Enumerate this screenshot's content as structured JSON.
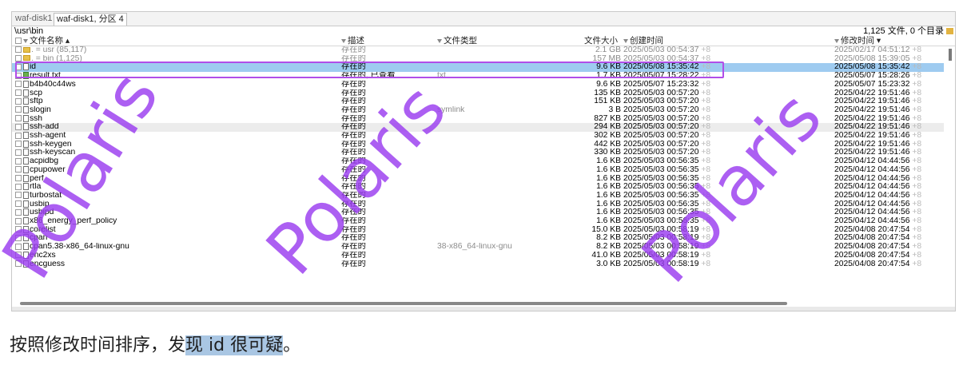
{
  "tabs": {
    "inactive": "waf-disk1",
    "active": "waf-disk1, 分区 4"
  },
  "path": "\\usr\\bin",
  "summary": "1,125 文件, 0 个目录",
  "columns": {
    "name": "文件名称 ▴",
    "desc": "描述",
    "type": "文件类型",
    "size": "文件大小",
    "ctime": "创建时间",
    "mtime": "修改时间 ▾"
  },
  "rows": [
    {
      "name": ".  =  usr (85,117)",
      "desc": "存在的",
      "type": "",
      "size": "2.1 GB",
      "ctime": "2025/05/03  00:54:37",
      "tz": "+8",
      "mtime": "2025/02/17  04:51:12",
      "mtz": "+8",
      "icon": "folder",
      "dim": true
    },
    {
      "name": ".  =  bin (1,125)",
      "desc": "存在的",
      "type": "",
      "size": "157 MB",
      "ctime": "2025/05/03  00:54:37",
      "tz": "+8",
      "mtime": "2025/05/08  15:39:05",
      "mtz": "+8",
      "icon": "folder",
      "dim": true
    },
    {
      "name": "id",
      "desc": "存在的",
      "type": "",
      "size": "9.6 KB",
      "ctime": "2025/05/08  15:35:42",
      "tz": "+8",
      "mtime": "2025/05/08  15:35:42",
      "mtz": "+8",
      "icon": "file",
      "selected": true
    },
    {
      "name": "result.txt",
      "desc": "存在的, 已查看",
      "type": "txt",
      "size": "1.7 KB",
      "ctime": "2025/05/07  15:28:22",
      "tz": "+8",
      "mtime": "2025/05/07  15:28:26",
      "mtz": "+8",
      "icon": "green"
    },
    {
      "name": "b4b40c44ws",
      "desc": "存在的",
      "type": "",
      "size": "9.6 KB",
      "ctime": "2025/05/07  15:23:32",
      "tz": "+8",
      "mtime": "2025/05/07  15:23:32",
      "mtz": "+8",
      "icon": "file"
    },
    {
      "name": "scp",
      "desc": "存在的",
      "type": "",
      "size": "135 KB",
      "ctime": "2025/05/03  00:57:20",
      "tz": "+8",
      "mtime": "2025/04/22  19:51:46",
      "mtz": "+8",
      "icon": "file"
    },
    {
      "name": "sftp",
      "desc": "存在的",
      "type": "",
      "size": "151 KB",
      "ctime": "2025/05/03  00:57:20",
      "tz": "+8",
      "mtime": "2025/04/22  19:51:46",
      "mtz": "+8",
      "icon": "file"
    },
    {
      "name": "slogin",
      "desc": "存在的",
      "type": "symlink",
      "size": "3 B",
      "ctime": "2025/05/03  00:57:20",
      "tz": "+8",
      "mtime": "2025/04/22  19:51:46",
      "mtz": "+8",
      "icon": "file"
    },
    {
      "name": "ssh",
      "desc": "存在的",
      "type": "",
      "size": "827 KB",
      "ctime": "2025/05/03  00:57:20",
      "tz": "+8",
      "mtime": "2025/04/22  19:51:46",
      "mtz": "+8",
      "icon": "file"
    },
    {
      "name": "ssh-add",
      "desc": "存在的",
      "type": "",
      "size": "294 KB",
      "ctime": "2025/05/03  00:57:20",
      "tz": "+8",
      "mtime": "2025/04/22  19:51:46",
      "mtz": "+8",
      "icon": "file",
      "shade": true
    },
    {
      "name": "ssh-agent",
      "desc": "存在的",
      "type": "",
      "size": "302 KB",
      "ctime": "2025/05/03  00:57:20",
      "tz": "+8",
      "mtime": "2025/04/22  19:51:46",
      "mtz": "+8",
      "icon": "file"
    },
    {
      "name": "ssh-keygen",
      "desc": "存在的",
      "type": "",
      "size": "442 KB",
      "ctime": "2025/05/03  00:57:20",
      "tz": "+8",
      "mtime": "2025/04/22  19:51:46",
      "mtz": "+8",
      "icon": "file"
    },
    {
      "name": "ssh-keyscan",
      "desc": "存在的",
      "type": "",
      "size": "330 KB",
      "ctime": "2025/05/03  00:57:20",
      "tz": "+8",
      "mtime": "2025/04/22  19:51:46",
      "mtz": "+8",
      "icon": "file"
    },
    {
      "name": "acpidbg",
      "desc": "存在的",
      "type": "",
      "size": "1.6 KB",
      "ctime": "2025/05/03  00:56:35",
      "tz": "+8",
      "mtime": "2025/04/12  04:44:56",
      "mtz": "+8",
      "icon": "file"
    },
    {
      "name": "cpupower",
      "desc": "存在的",
      "type": "",
      "size": "1.6 KB",
      "ctime": "2025/05/03  00:56:35",
      "tz": "+8",
      "mtime": "2025/04/12  04:44:56",
      "mtz": "+8",
      "icon": "file"
    },
    {
      "name": "perf",
      "desc": "存在的",
      "type": "",
      "size": "1.6 KB",
      "ctime": "2025/05/03  00:56:35",
      "tz": "+8",
      "mtime": "2025/04/12  04:44:56",
      "mtz": "+8",
      "icon": "file"
    },
    {
      "name": "rtla",
      "desc": "存在的",
      "type": "",
      "size": "1.6 KB",
      "ctime": "2025/05/03  00:56:35",
      "tz": "+8",
      "mtime": "2025/04/12  04:44:56",
      "mtz": "+8",
      "icon": "file"
    },
    {
      "name": "turbostat",
      "desc": "存在的",
      "type": "",
      "size": "1.6 KB",
      "ctime": "2025/05/03  00:56:35",
      "tz": "+8",
      "mtime": "2025/04/12  04:44:56",
      "mtz": "+8",
      "icon": "file"
    },
    {
      "name": "usbip",
      "desc": "存在的",
      "type": "",
      "size": "1.6 KB",
      "ctime": "2025/05/03  00:56:35",
      "tz": "+8",
      "mtime": "2025/04/12  04:44:56",
      "mtz": "+8",
      "icon": "file"
    },
    {
      "name": "usbipd",
      "desc": "存在的",
      "type": "",
      "size": "1.6 KB",
      "ctime": "2025/05/03  00:56:35",
      "tz": "+8",
      "mtime": "2025/04/12  04:44:56",
      "mtz": "+8",
      "icon": "file"
    },
    {
      "name": "x86_energy_perf_policy",
      "desc": "存在的",
      "type": "",
      "size": "1.6 KB",
      "ctime": "2025/05/03  00:56:35",
      "tz": "+8",
      "mtime": "2025/04/12  04:44:56",
      "mtz": "+8",
      "icon": "file"
    },
    {
      "name": "corelist",
      "desc": "存在的",
      "type": "",
      "size": "15.0 KB",
      "ctime": "2025/05/03  00:58:19",
      "tz": "+8",
      "mtime": "2025/04/08  20:47:54",
      "mtz": "+8",
      "icon": "file"
    },
    {
      "name": "cpan",
      "desc": "存在的",
      "type": "",
      "size": "8.2 KB",
      "ctime": "2025/05/03  00:58:19",
      "tz": "+8",
      "mtime": "2025/04/08  20:47:54",
      "mtz": "+8",
      "icon": "file"
    },
    {
      "name": "cpan5.38-x86_64-linux-gnu",
      "desc": "存在的",
      "type": "38-x86_64-linux-gnu",
      "size": "8.2 KB",
      "ctime": "2025/05/03  00:58:19",
      "tz": "+8",
      "mtime": "2025/04/08  20:47:54",
      "mtz": "+8",
      "icon": "file"
    },
    {
      "name": "enc2xs",
      "desc": "存在的",
      "type": "",
      "size": "41.0 KB",
      "ctime": "2025/05/03  00:58:19",
      "tz": "+8",
      "mtime": "2025/04/08  20:47:54",
      "mtz": "+8",
      "icon": "file"
    },
    {
      "name": "encguess",
      "desc": "存在的",
      "type": "",
      "size": "3.0 KB",
      "ctime": "2025/05/03  00:58:19",
      "tz": "+8",
      "mtime": "2025/04/08  20:47:54",
      "mtz": "+8",
      "icon": "file"
    }
  ],
  "watermark": "Polaris",
  "caption": {
    "prefix": "按照修改时间排序，发",
    "highlight": "现 id 很可疑",
    "suffix": "。"
  },
  "colors": {
    "selection": "#9ecbf0",
    "highlight_box": "#b14ee8",
    "watermark": "#9b3df0"
  }
}
